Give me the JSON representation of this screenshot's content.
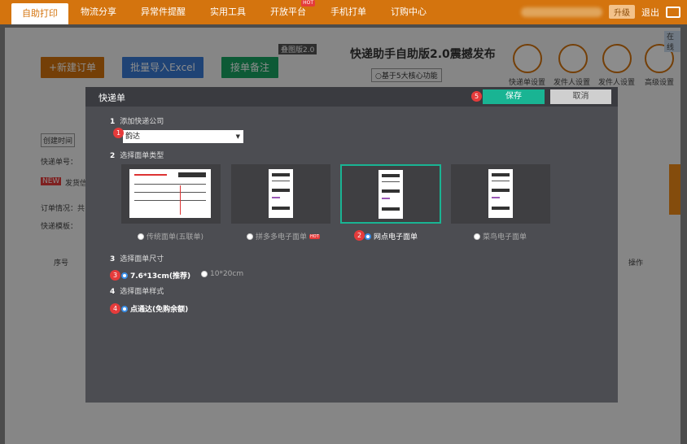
{
  "nav": {
    "tabs": [
      "自助打印",
      "物流分享",
      "异常件提醒",
      "实用工具",
      "开放平台",
      "手机打单",
      "订购中心"
    ],
    "hot_label": "HOT",
    "upgrade": "升级",
    "logout": "退出"
  },
  "background": {
    "new_order": "+新建订单",
    "batch_import": "批量导入Excel",
    "accept_order": "接单备注",
    "banner_badge": "叠图版2.0",
    "banner_title": "快递助手自助版2.0震撼发布",
    "banner_sub": "○基于5大核心功能",
    "settings": [
      "快递单设置",
      "发件人设置",
      "发件人设置",
      "高级设置"
    ],
    "create_time": "创建时间",
    "express_no": "快递单号：",
    "new_badge": "NEW",
    "send_label": "发货信",
    "order_status": "订单情况：共",
    "express_template": "快递模板：",
    "col_seq": "序号",
    "col_action": "操作",
    "online": "在线"
  },
  "modal": {
    "title": "快递单",
    "save": "保存",
    "cancel": "取消",
    "step1_num": "1",
    "step1_label": "添加快递公司",
    "selected_company": "韵达",
    "step2_num": "2",
    "step2_label": "选择面单类型",
    "types": [
      "传统面单(五联单)",
      "拼多多电子面单",
      "网点电子面单",
      "菜鸟电子面单"
    ],
    "type_hot": "HOT",
    "selected_type_index": 2,
    "step3_num": "3",
    "step3_label": "选择面单尺寸",
    "sizes": [
      "7.6*13cm(推荐)",
      "10*20cm"
    ],
    "step4_num": "4",
    "step4_label": "选择面单样式",
    "style": "点通达(免购余额)",
    "badges": [
      "1",
      "2",
      "3",
      "4",
      "5"
    ]
  },
  "colors": {
    "accent_orange": "#d4740e",
    "save_green": "#19b493",
    "badge_red": "#e53b3b",
    "radio_blue": "#3a8ee6"
  }
}
